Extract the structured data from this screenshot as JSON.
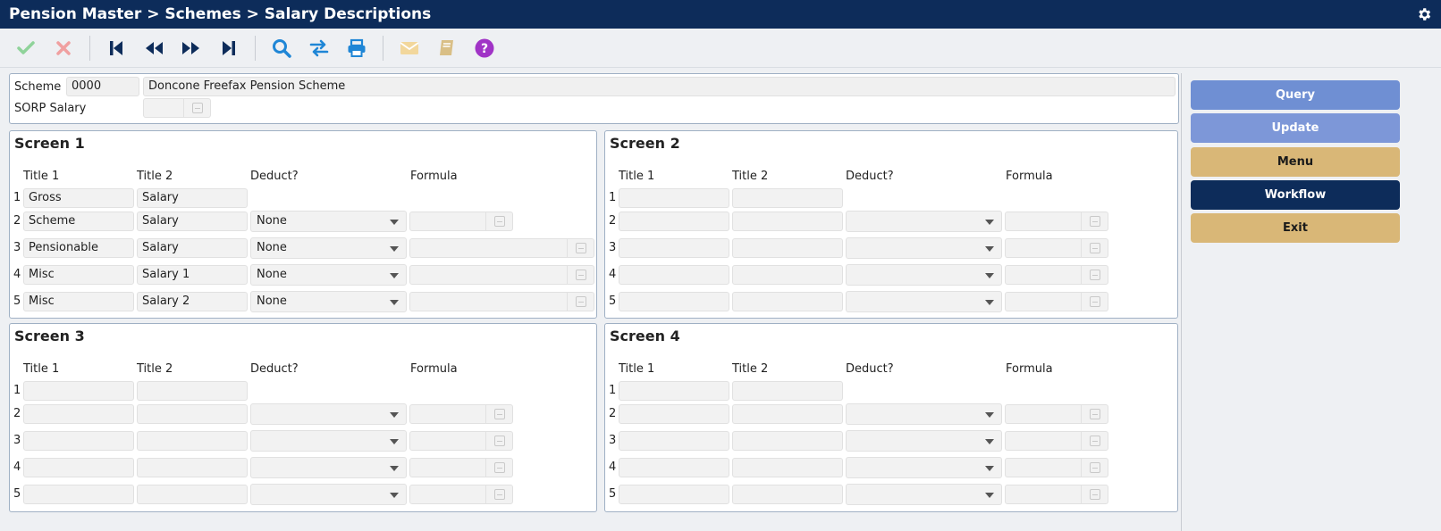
{
  "header": {
    "title": "Pension Master > Schemes > Salary Descriptions"
  },
  "toolbar": {
    "buttons": [
      {
        "name": "check-icon",
        "color": "#8fd39a"
      },
      {
        "name": "close-icon",
        "color": "#f0a0a0"
      },
      {
        "name": "first-record-icon",
        "color": "#0d2c5a"
      },
      {
        "name": "previous-record-icon",
        "color": "#0d2c5a"
      },
      {
        "name": "next-record-icon",
        "color": "#0d2c5a"
      },
      {
        "name": "last-record-icon",
        "color": "#0d2c5a"
      },
      {
        "name": "search-icon",
        "color": "#1f86d6"
      },
      {
        "name": "swap-icon",
        "color": "#1f86d6"
      },
      {
        "name": "print-icon",
        "color": "#1f86d6"
      },
      {
        "name": "mail-icon",
        "color": "#f2d79c"
      },
      {
        "name": "book-icon",
        "color": "#d9bf86"
      },
      {
        "name": "help-icon",
        "color": "#a033c6"
      }
    ]
  },
  "scheme": {
    "label": "Scheme",
    "code": "0000",
    "name": "Doncone Freefax Pension Scheme",
    "sorp_label": "SORP Salary",
    "sorp_value": ""
  },
  "columns": {
    "title1": "Title 1",
    "title2": "Title 2",
    "deduct": "Deduct?",
    "formula": "Formula"
  },
  "screens": [
    {
      "title": "Screen 1",
      "rows": [
        {
          "num": "1",
          "title1": "Gross",
          "title2": "Salary",
          "deduct": "",
          "formula": ""
        },
        {
          "num": "2",
          "title1": "Scheme",
          "title2": "Salary",
          "deduct": "None",
          "formula": ""
        },
        {
          "num": "3",
          "title1": "Pensionable",
          "title2": "Salary",
          "deduct": "None",
          "formula": ""
        },
        {
          "num": "4",
          "title1": "Misc",
          "title2": "Salary 1",
          "deduct": "None",
          "formula": ""
        },
        {
          "num": "5",
          "title1": "Misc",
          "title2": "Salary 2",
          "deduct": "None",
          "formula": ""
        }
      ]
    },
    {
      "title": "Screen 2",
      "rows": [
        {
          "num": "1",
          "title1": "",
          "title2": "",
          "deduct": "",
          "formula": ""
        },
        {
          "num": "2",
          "title1": "",
          "title2": "",
          "deduct": "",
          "formula": ""
        },
        {
          "num": "3",
          "title1": "",
          "title2": "",
          "deduct": "",
          "formula": ""
        },
        {
          "num": "4",
          "title1": "",
          "title2": "",
          "deduct": "",
          "formula": ""
        },
        {
          "num": "5",
          "title1": "",
          "title2": "",
          "deduct": "",
          "formula": ""
        }
      ]
    },
    {
      "title": "Screen 3",
      "rows": [
        {
          "num": "1",
          "title1": "",
          "title2": "",
          "deduct": "",
          "formula": ""
        },
        {
          "num": "2",
          "title1": "",
          "title2": "",
          "deduct": "",
          "formula": ""
        },
        {
          "num": "3",
          "title1": "",
          "title2": "",
          "deduct": "",
          "formula": ""
        },
        {
          "num": "4",
          "title1": "",
          "title2": "",
          "deduct": "",
          "formula": ""
        },
        {
          "num": "5",
          "title1": "",
          "title2": "",
          "deduct": "",
          "formula": ""
        }
      ]
    },
    {
      "title": "Screen 4",
      "rows": [
        {
          "num": "1",
          "title1": "",
          "title2": "",
          "deduct": "",
          "formula": ""
        },
        {
          "num": "2",
          "title1": "",
          "title2": "",
          "deduct": "",
          "formula": ""
        },
        {
          "num": "3",
          "title1": "",
          "title2": "",
          "deduct": "",
          "formula": ""
        },
        {
          "num": "4",
          "title1": "",
          "title2": "",
          "deduct": "",
          "formula": ""
        },
        {
          "num": "5",
          "title1": "",
          "title2": "",
          "deduct": "",
          "formula": ""
        }
      ]
    }
  ],
  "sidebar": {
    "buttons": [
      {
        "label": "Query",
        "bg": "#6f8fd3",
        "fg": "#ffffff"
      },
      {
        "label": "Update",
        "bg": "#7d97d8",
        "fg": "#ffffff"
      },
      {
        "label": "Menu",
        "bg": "#d9b777",
        "fg": "#1a1a1a"
      },
      {
        "label": "Workflow",
        "bg": "#0d2c5a",
        "fg": "#ffffff"
      },
      {
        "label": "Exit",
        "bg": "#d9b777",
        "fg": "#1a1a1a"
      }
    ]
  }
}
